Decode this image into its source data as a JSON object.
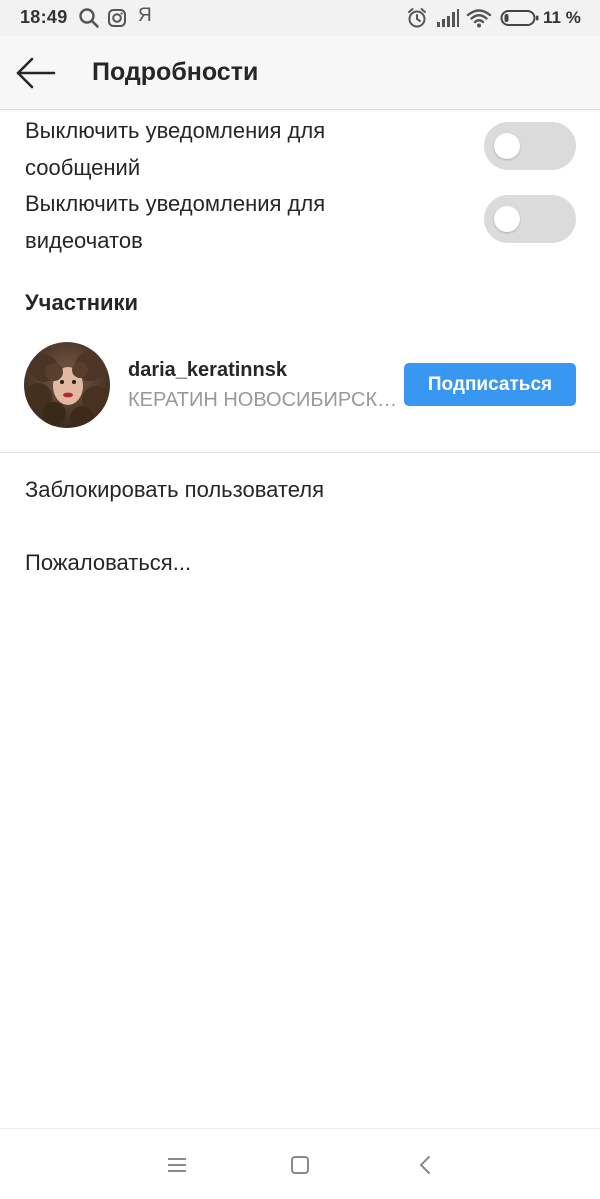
{
  "status_bar": {
    "time": "18:49",
    "ya_glyph": "Я",
    "battery": "11 %",
    "icons": [
      "search-icon",
      "instagram-icon",
      "yandex-icon",
      "alarm-icon",
      "signal-icon",
      "wifi-icon",
      "battery-icon"
    ]
  },
  "header": {
    "title": "Подробности",
    "back_icon": "arrow-left-icon"
  },
  "settings": {
    "mute_messages": "Выключить уведомления для сообщений",
    "mute_video_chats": "Выключить уведомления для видеочатов",
    "mute_messages_on": false,
    "mute_video_chats_on": false
  },
  "participants": {
    "title": "Участники",
    "members": [
      {
        "username": "daria_keratinnsk",
        "full_name": "КЕРАТИН НОВОСИБИРСК…",
        "follow_label": "Подписаться"
      }
    ]
  },
  "actions": {
    "block": "Заблокировать пользователя",
    "report": "Пожаловаться..."
  },
  "nav_bar": {
    "icons": [
      "menu-icon",
      "home-square-icon",
      "back-chevron-icon"
    ]
  },
  "colors": {
    "accent": "#3897f0",
    "toggle_off": "#dbdbdb",
    "secondary_text": "#999999"
  }
}
